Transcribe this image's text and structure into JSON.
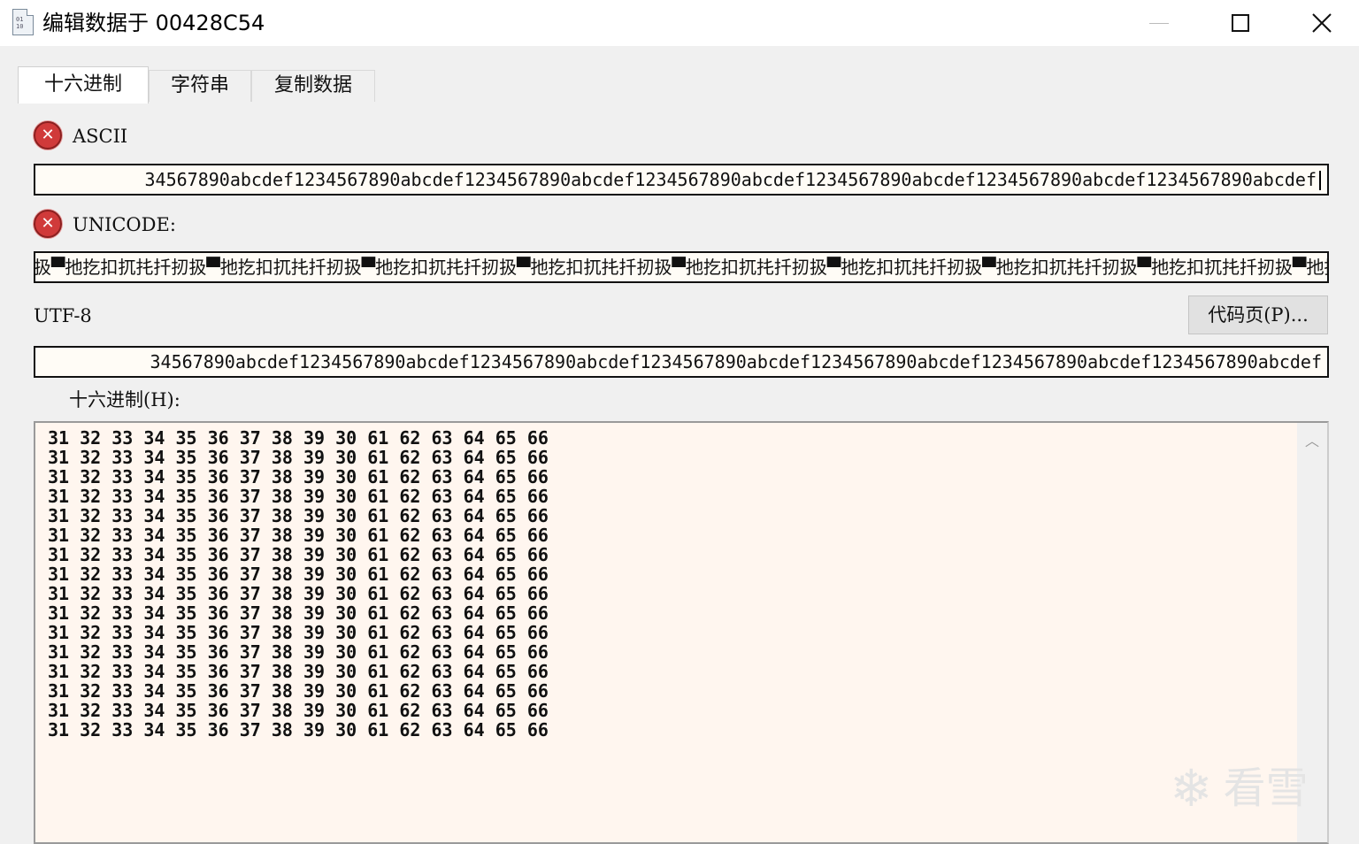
{
  "window": {
    "title": "编辑数据于 00428C54",
    "icon": "binary-file-icon",
    "icon_glyph": "01\n10"
  },
  "tabs": [
    {
      "label": "十六进制",
      "active": true
    },
    {
      "label": "字符串",
      "active": false
    },
    {
      "label": "复制数据",
      "active": false
    }
  ],
  "ascii": {
    "label": "ASCII",
    "status_icon": "error-icon",
    "value": "34567890abcdef1234567890abcdef1234567890abcdef1234567890abcdef1234567890abcdef1234567890abcdef1234567890abcdef"
  },
  "unicode": {
    "label": "UNICODE:",
    "status_icon": "error-icon",
    "value": "扱▀扡扢扣扤扥扦扨扱▀扡扢扣扤扥扦扨扱▀扡扢扣扤扥扦扨扱▀扡扢扣扤扥扦扨扱▀扡扢扣扤扥扦扨扱▀扡扢扣扤扥扦扨扱▀扡扢扣扤扥扦扨扱▀扡扢扣扤扥扦扨扱▀扡扢扣"
  },
  "utf8": {
    "label": "UTF-8",
    "value": "34567890abcdef1234567890abcdef1234567890abcdef1234567890abcdef1234567890abcdef1234567890abcdef1234567890abcdef",
    "codepage_button": "代码页(P)..."
  },
  "hex": {
    "label": "十六进制(H):",
    "lines": [
      "31 32 33 34 35 36 37 38 39 30 61 62 63 64 65 66",
      "31 32 33 34 35 36 37 38 39 30 61 62 63 64 65 66",
      "31 32 33 34 35 36 37 38 39 30 61 62 63 64 65 66",
      "31 32 33 34 35 36 37 38 39 30 61 62 63 64 65 66",
      "31 32 33 34 35 36 37 38 39 30 61 62 63 64 65 66",
      "31 32 33 34 35 36 37 38 39 30 61 62 63 64 65 66",
      "31 32 33 34 35 36 37 38 39 30 61 62 63 64 65 66",
      "31 32 33 34 35 36 37 38 39 30 61 62 63 64 65 66",
      "31 32 33 34 35 36 37 38 39 30 61 62 63 64 65 66",
      "31 32 33 34 35 36 37 38 39 30 61 62 63 64 65 66",
      "31 32 33 34 35 36 37 38 39 30 61 62 63 64 65 66",
      "31 32 33 34 35 36 37 38 39 30 61 62 63 64 65 66",
      "31 32 33 34 35 36 37 38 39 30 61 62 63 64 65 66",
      "31 32 33 34 35 36 37 38 39 30 61 62 63 64 65 66",
      "31 32 33 34 35 36 37 38 39 30 61 62 63 64 65 66",
      "31 32 33 34 35 36 37 38 39 30 61 62 63 64 65 66"
    ]
  },
  "watermark": {
    "text": "看雪",
    "icon": "snowflake-icon"
  }
}
